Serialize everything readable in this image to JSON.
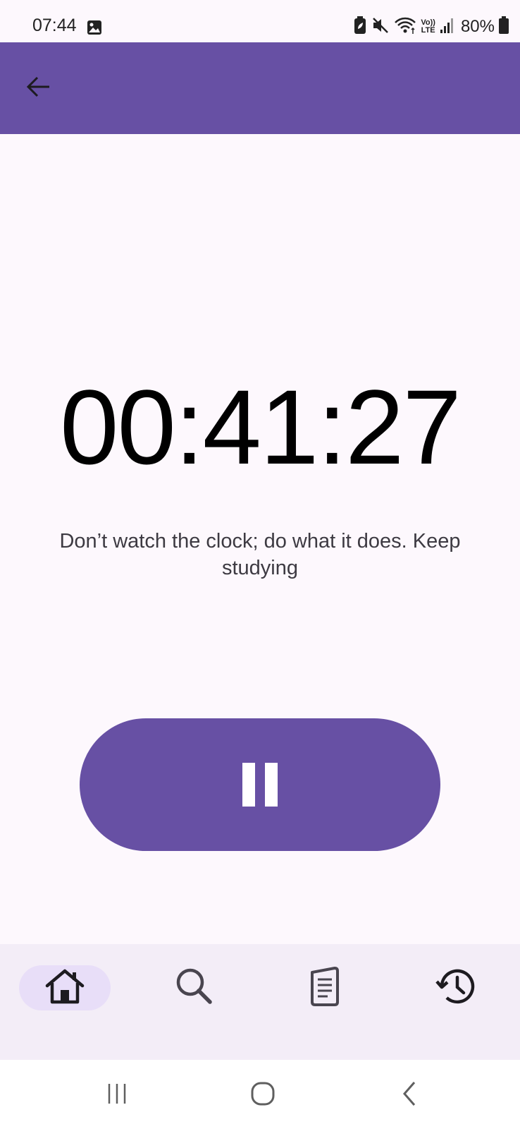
{
  "status_bar": {
    "time": "07:44",
    "battery_percent": "80%",
    "icons": [
      "gallery-icon",
      "battery-saver-icon",
      "mute-icon",
      "wifi-icon",
      "volte-icon",
      "signal-icon",
      "battery-icon"
    ],
    "volte_label_top": "Vo))",
    "volte_label_bottom": "LTE"
  },
  "app_bar": {
    "back_icon": "arrow-left-icon",
    "color": "#6750a4"
  },
  "timer": {
    "value": "00:41:27"
  },
  "quote": {
    "text": "Don’t watch the clock; do what it does. Keep studying"
  },
  "pause_button": {
    "icon": "pause-icon",
    "color": "#6750a4"
  },
  "bottom_nav": {
    "items": [
      {
        "icon": "home-icon",
        "active": true
      },
      {
        "icon": "search-icon",
        "active": false
      },
      {
        "icon": "notes-icon",
        "active": false
      },
      {
        "icon": "history-icon",
        "active": false
      }
    ],
    "active_pill_color": "#e8def8",
    "background": "#f3edf7"
  },
  "system_nav": {
    "buttons": [
      "recents-icon",
      "home-circle-icon",
      "back-chevron-icon"
    ]
  }
}
